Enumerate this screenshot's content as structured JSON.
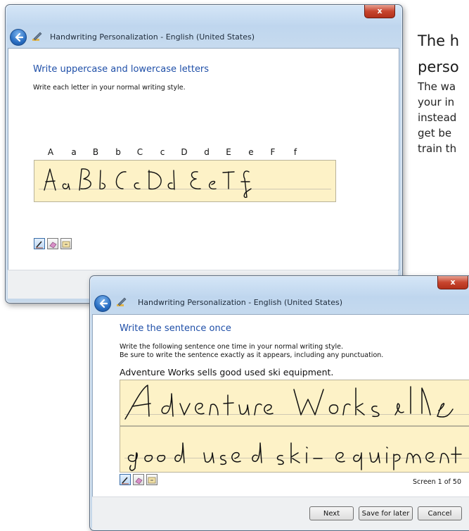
{
  "article": {
    "heading_lines": [
      "The h",
      "perso"
    ],
    "body_lines": [
      "The wa",
      "your in",
      "instead",
      "get be",
      "train th"
    ]
  },
  "window1": {
    "title": "Handwriting Personalization - English (United States)",
    "close_label": "x",
    "heading": "Write uppercase and lowercase letters",
    "instruction": "Write each letter in your normal writing style.",
    "letters": [
      "A",
      "a",
      "B",
      "b",
      "C",
      "c",
      "D",
      "d",
      "E",
      "e",
      "F",
      "f"
    ]
  },
  "window2": {
    "title": "Handwriting Personalization - English (United States)",
    "close_label": "x",
    "heading": "Write the sentence once",
    "instruction_line1": "Write the following sentence one time in your normal writing style.",
    "instruction_line2": "Be sure to write the sentence exactly as it appears, including any punctuation.",
    "sentence": "Adventure Works sells good used ski equipment.",
    "screen_counter": "Screen 1 of 50",
    "buttons": {
      "next": "Next",
      "save_for_later": "Save for later",
      "cancel": "Cancel"
    }
  },
  "tools": [
    "pen-icon",
    "eraser-icon",
    "insert-icon"
  ]
}
